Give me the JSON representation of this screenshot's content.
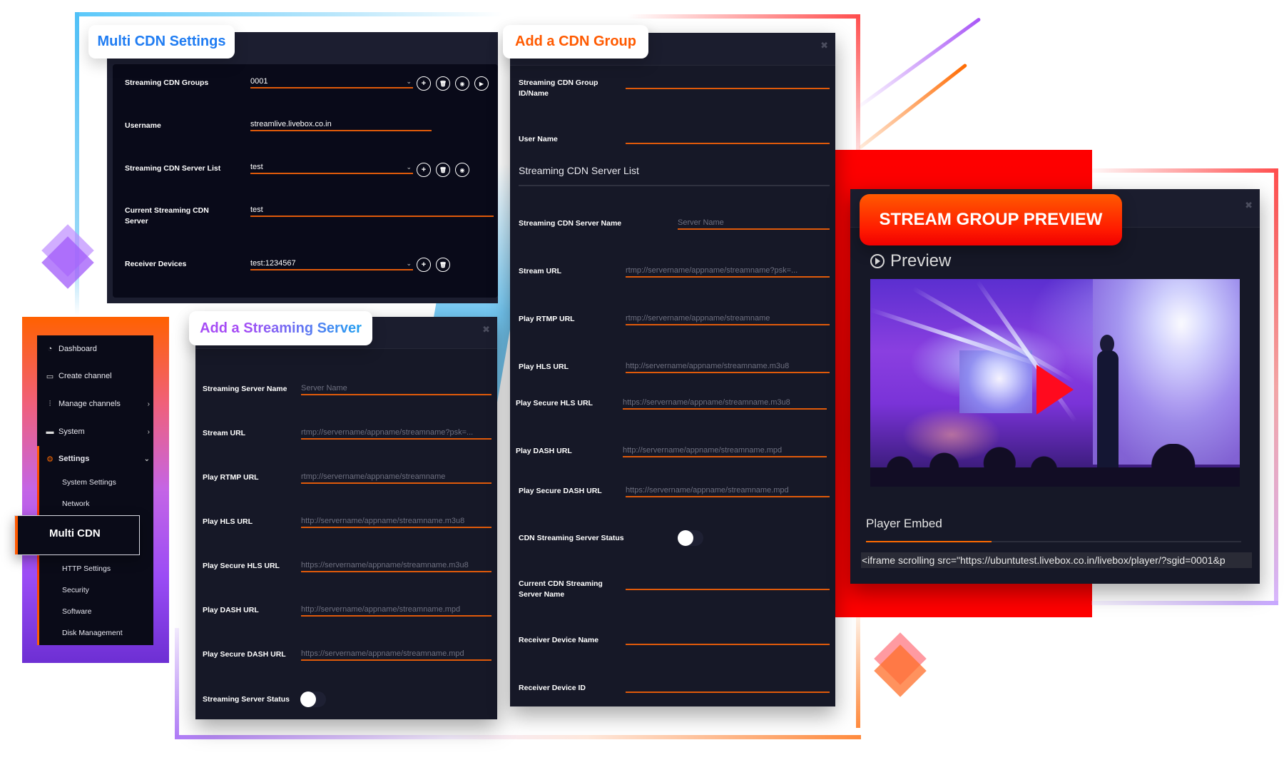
{
  "multi_cdn_settings": {
    "title": "Multi CDN Settings",
    "rows": [
      {
        "label": "Streaming CDN Groups",
        "value": "0001",
        "type": "select",
        "actions": [
          "add",
          "delete",
          "view",
          "play"
        ]
      },
      {
        "label": "Username",
        "value": "streamlive.livebox.co.in",
        "type": "text",
        "actions": []
      },
      {
        "label": "Streaming CDN Server List",
        "value": "test",
        "type": "select",
        "actions": [
          "add",
          "delete",
          "view"
        ]
      },
      {
        "label": "Current Streaming CDN Server",
        "value": "test",
        "type": "text",
        "actions": []
      },
      {
        "label": "Receiver Devices",
        "value": "test:1234567",
        "type": "select",
        "actions": [
          "add",
          "delete"
        ]
      }
    ]
  },
  "sidebar": {
    "items": [
      {
        "label": "Dashboard",
        "icon": "speedometer-icon",
        "chevron": ""
      },
      {
        "label": "Create channel",
        "icon": "monitor-icon",
        "chevron": "›"
      },
      {
        "label": "Manage channels",
        "icon": "sliders-icon",
        "chevron": "›"
      },
      {
        "label": "System",
        "icon": "desktop-icon",
        "chevron": "›"
      },
      {
        "label": "Settings",
        "icon": "gear-icon",
        "chevron": "⌄"
      }
    ],
    "sub_items": [
      "System Settings",
      "Network",
      "Multi CDN",
      "HTTP Settings",
      "Security",
      "Software",
      "Disk Management"
    ],
    "active": "Multi CDN"
  },
  "add_streaming_server": {
    "title_prefix": "Add a ",
    "title_rest": "Streaming Server",
    "fields": [
      {
        "label": "Streaming Server Name",
        "placeholder": "Server Name"
      },
      {
        "label": "Stream URL",
        "placeholder": "rtmp://servername/appname/streamname?psk=..."
      },
      {
        "label": "Play RTMP URL",
        "placeholder": "rtmp://servername/appname/streamname"
      },
      {
        "label": "Play HLS URL",
        "placeholder": "http://servername/appname/streamname.m3u8"
      },
      {
        "label": "Play Secure HLS URL",
        "placeholder": "https://servername/appname/streamname.m3u8"
      },
      {
        "label": "Play DASH URL",
        "placeholder": "http://servername/appname/streamname.mpd"
      },
      {
        "label": "Play Secure DASH URL",
        "placeholder": "https://servername/appname/streamname.mpd"
      }
    ],
    "status_label": "Streaming Server Status",
    "status_on": false
  },
  "add_cdn_group": {
    "title": "Add a CDN Group",
    "group_id_label": "Streaming CDN Group ID/Name",
    "user_name_label": "User Name",
    "server_list_heading": "Streaming CDN Server List",
    "fields": [
      {
        "label": "Streaming CDN Server Name",
        "placeholder": "Server Name"
      },
      {
        "label": "Stream URL",
        "placeholder": "rtmp://servername/appname/streamname?psk=..."
      },
      {
        "label": "Play RTMP URL",
        "placeholder": "rtmp://servername/appname/streamname"
      },
      {
        "label": "Play HLS URL",
        "placeholder": "http://servername/appname/streamname.m3u8"
      },
      {
        "label": "Play Secure HLS URL",
        "placeholder": "https://servername/appname/streamname.m3u8"
      },
      {
        "label": "Play DASH URL",
        "placeholder": "http://servername/appname/streamname.mpd"
      },
      {
        "label": "Play Secure DASH URL",
        "placeholder": "https://servername/appname/streamname.mpd"
      }
    ],
    "status_label": "CDN Streaming Server Status",
    "status_on": false,
    "current_server_label": "Current CDN Streaming Server Name",
    "receiver_name_label": "Receiver Device Name",
    "receiver_id_label": "Receiver Device ID"
  },
  "stream_group_preview": {
    "title": "STREAM GROUP PREVIEW",
    "preview_label": "Preview",
    "embed_label": "Player Embed",
    "embed_code": "<iframe scrolling src=\"https://ubuntutest.livebox.co.in/livebox/player/?sgid=0001&p"
  },
  "colors": {
    "accent_orange": "#e05a0a",
    "panel_dark": "#161827",
    "title_blue": "#1f7cf2",
    "title_purple": "#a64cf5",
    "title_orange": "#ff5a00",
    "preview_red": "#ff1a00"
  }
}
